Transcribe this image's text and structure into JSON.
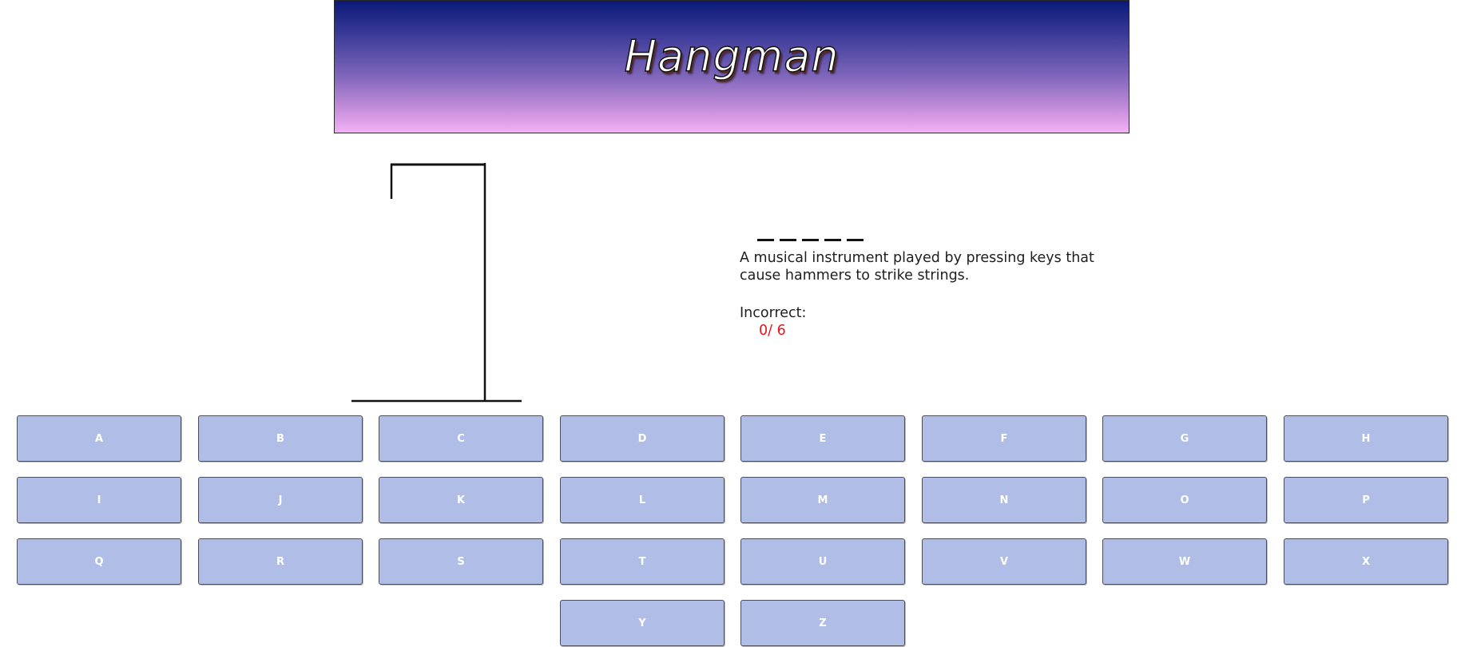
{
  "header": {
    "title": "Hangman",
    "gradient_colors": [
      "#0a1a78",
      "#7a63b8",
      "#f3b1f6"
    ]
  },
  "game": {
    "word_blank_count": 5,
    "word_blank_glyph": "_",
    "hint": "A musical instrument played by pressing keys that cause hammers to strike strings.",
    "incorrect_label": "Incorrect:",
    "incorrect_count": "0/ 6",
    "incorrect_color": "#e8141b",
    "wrong_guesses": 0,
    "max_wrong_guesses": 6
  },
  "keyboard": {
    "key_color": "#b0bde6",
    "letters": [
      "A",
      "B",
      "C",
      "D",
      "E",
      "F",
      "G",
      "H",
      "I",
      "J",
      "K",
      "L",
      "M",
      "N",
      "O",
      "P",
      "Q",
      "R",
      "S",
      "T",
      "U",
      "V",
      "W",
      "X",
      "Y",
      "Z"
    ]
  }
}
